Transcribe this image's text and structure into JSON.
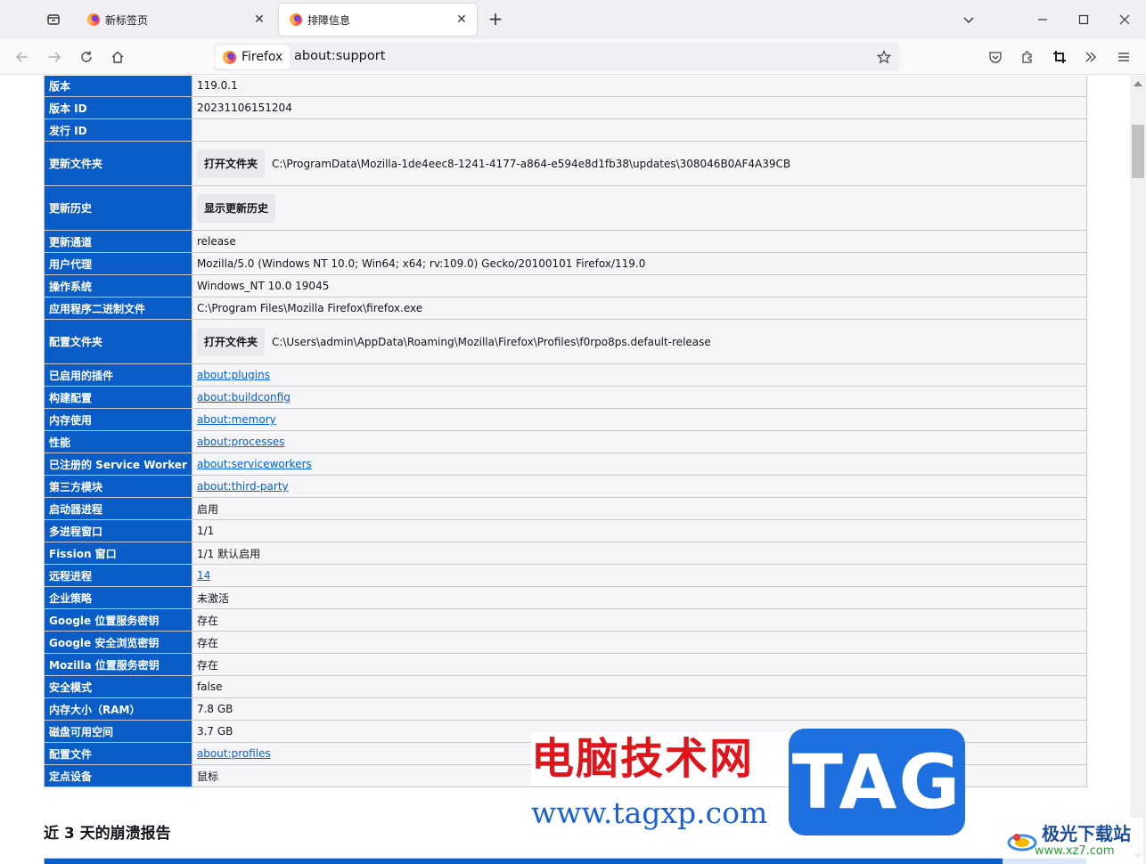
{
  "tabs": [
    {
      "title": "新标签页",
      "active": false
    },
    {
      "title": "排障信息",
      "active": true
    }
  ],
  "urlbar": {
    "identity": "Firefox",
    "url": "about:support"
  },
  "rows": [
    {
      "key": "版本",
      "value": "119.0.1"
    },
    {
      "key": "版本 ID",
      "value": "20231106151204"
    },
    {
      "key": "发行 ID",
      "value": ""
    },
    {
      "key": "更新文件夹",
      "button": "打开文件夹",
      "value": "C:\\ProgramData\\Mozilla-1de4eec8-1241-4177-a864-e594e8d1fb38\\updates\\308046B0AF4A39CB"
    },
    {
      "key": "更新历史",
      "button": "显示更新历史",
      "value": ""
    },
    {
      "key": "更新通道",
      "value": "release"
    },
    {
      "key": "用户代理",
      "value": "Mozilla/5.0 (Windows NT 10.0; Win64; x64; rv:109.0) Gecko/20100101 Firefox/119.0"
    },
    {
      "key": "操作系统",
      "value": "Windows_NT 10.0 19045"
    },
    {
      "key": "应用程序二进制文件",
      "value": "C:\\Program Files\\Mozilla Firefox\\firefox.exe"
    },
    {
      "key": "配置文件夹",
      "button": "打开文件夹",
      "value": "C:\\Users\\admin\\AppData\\Roaming\\Mozilla\\Firefox\\Profiles\\f0rpo8ps.default-release"
    },
    {
      "key": "已启用的插件",
      "link": "about:plugins"
    },
    {
      "key": "构建配置",
      "link": "about:buildconfig"
    },
    {
      "key": "内存使用",
      "link": "about:memory"
    },
    {
      "key": "性能",
      "link": "about:processes"
    },
    {
      "key": "已注册的 Service Worker",
      "link": "about:serviceworkers"
    },
    {
      "key": "第三方模块",
      "link": "about:third-party"
    },
    {
      "key": "启动器进程",
      "value": "启用"
    },
    {
      "key": "多进程窗口",
      "value": "1/1"
    },
    {
      "key": "Fission 窗口",
      "value": "1/1 默认启用"
    },
    {
      "key": "远程进程",
      "link": "14"
    },
    {
      "key": "企业策略",
      "value": "未激活"
    },
    {
      "key": "Google 位置服务密钥",
      "value": "存在"
    },
    {
      "key": "Google 安全浏览密钥",
      "value": "存在"
    },
    {
      "key": "Mozilla 位置服务密钥",
      "value": "存在"
    },
    {
      "key": "安全模式",
      "value": "false"
    },
    {
      "key": "内存大小（RAM）",
      "value": "7.8 GB"
    },
    {
      "key": "磁盘可用空间",
      "value": "3.7 GB"
    },
    {
      "key": "配置文件",
      "link": "about:profiles"
    },
    {
      "key": "定点设备",
      "value": "鼠标"
    }
  ],
  "crash_heading": "近 3 天的崩溃报告",
  "watermark": {
    "cn_text": "电脑技术网",
    "url": "www.tagxp.com",
    "tag": "TAG",
    "site_name": "极光下载站",
    "site_url": "www.xz7.com"
  },
  "colors": {
    "header_cell": "#0a5cc7",
    "link": "#0061e0",
    "accent_tag": "#1e6fe0",
    "watermark_red": "#e0151b"
  }
}
